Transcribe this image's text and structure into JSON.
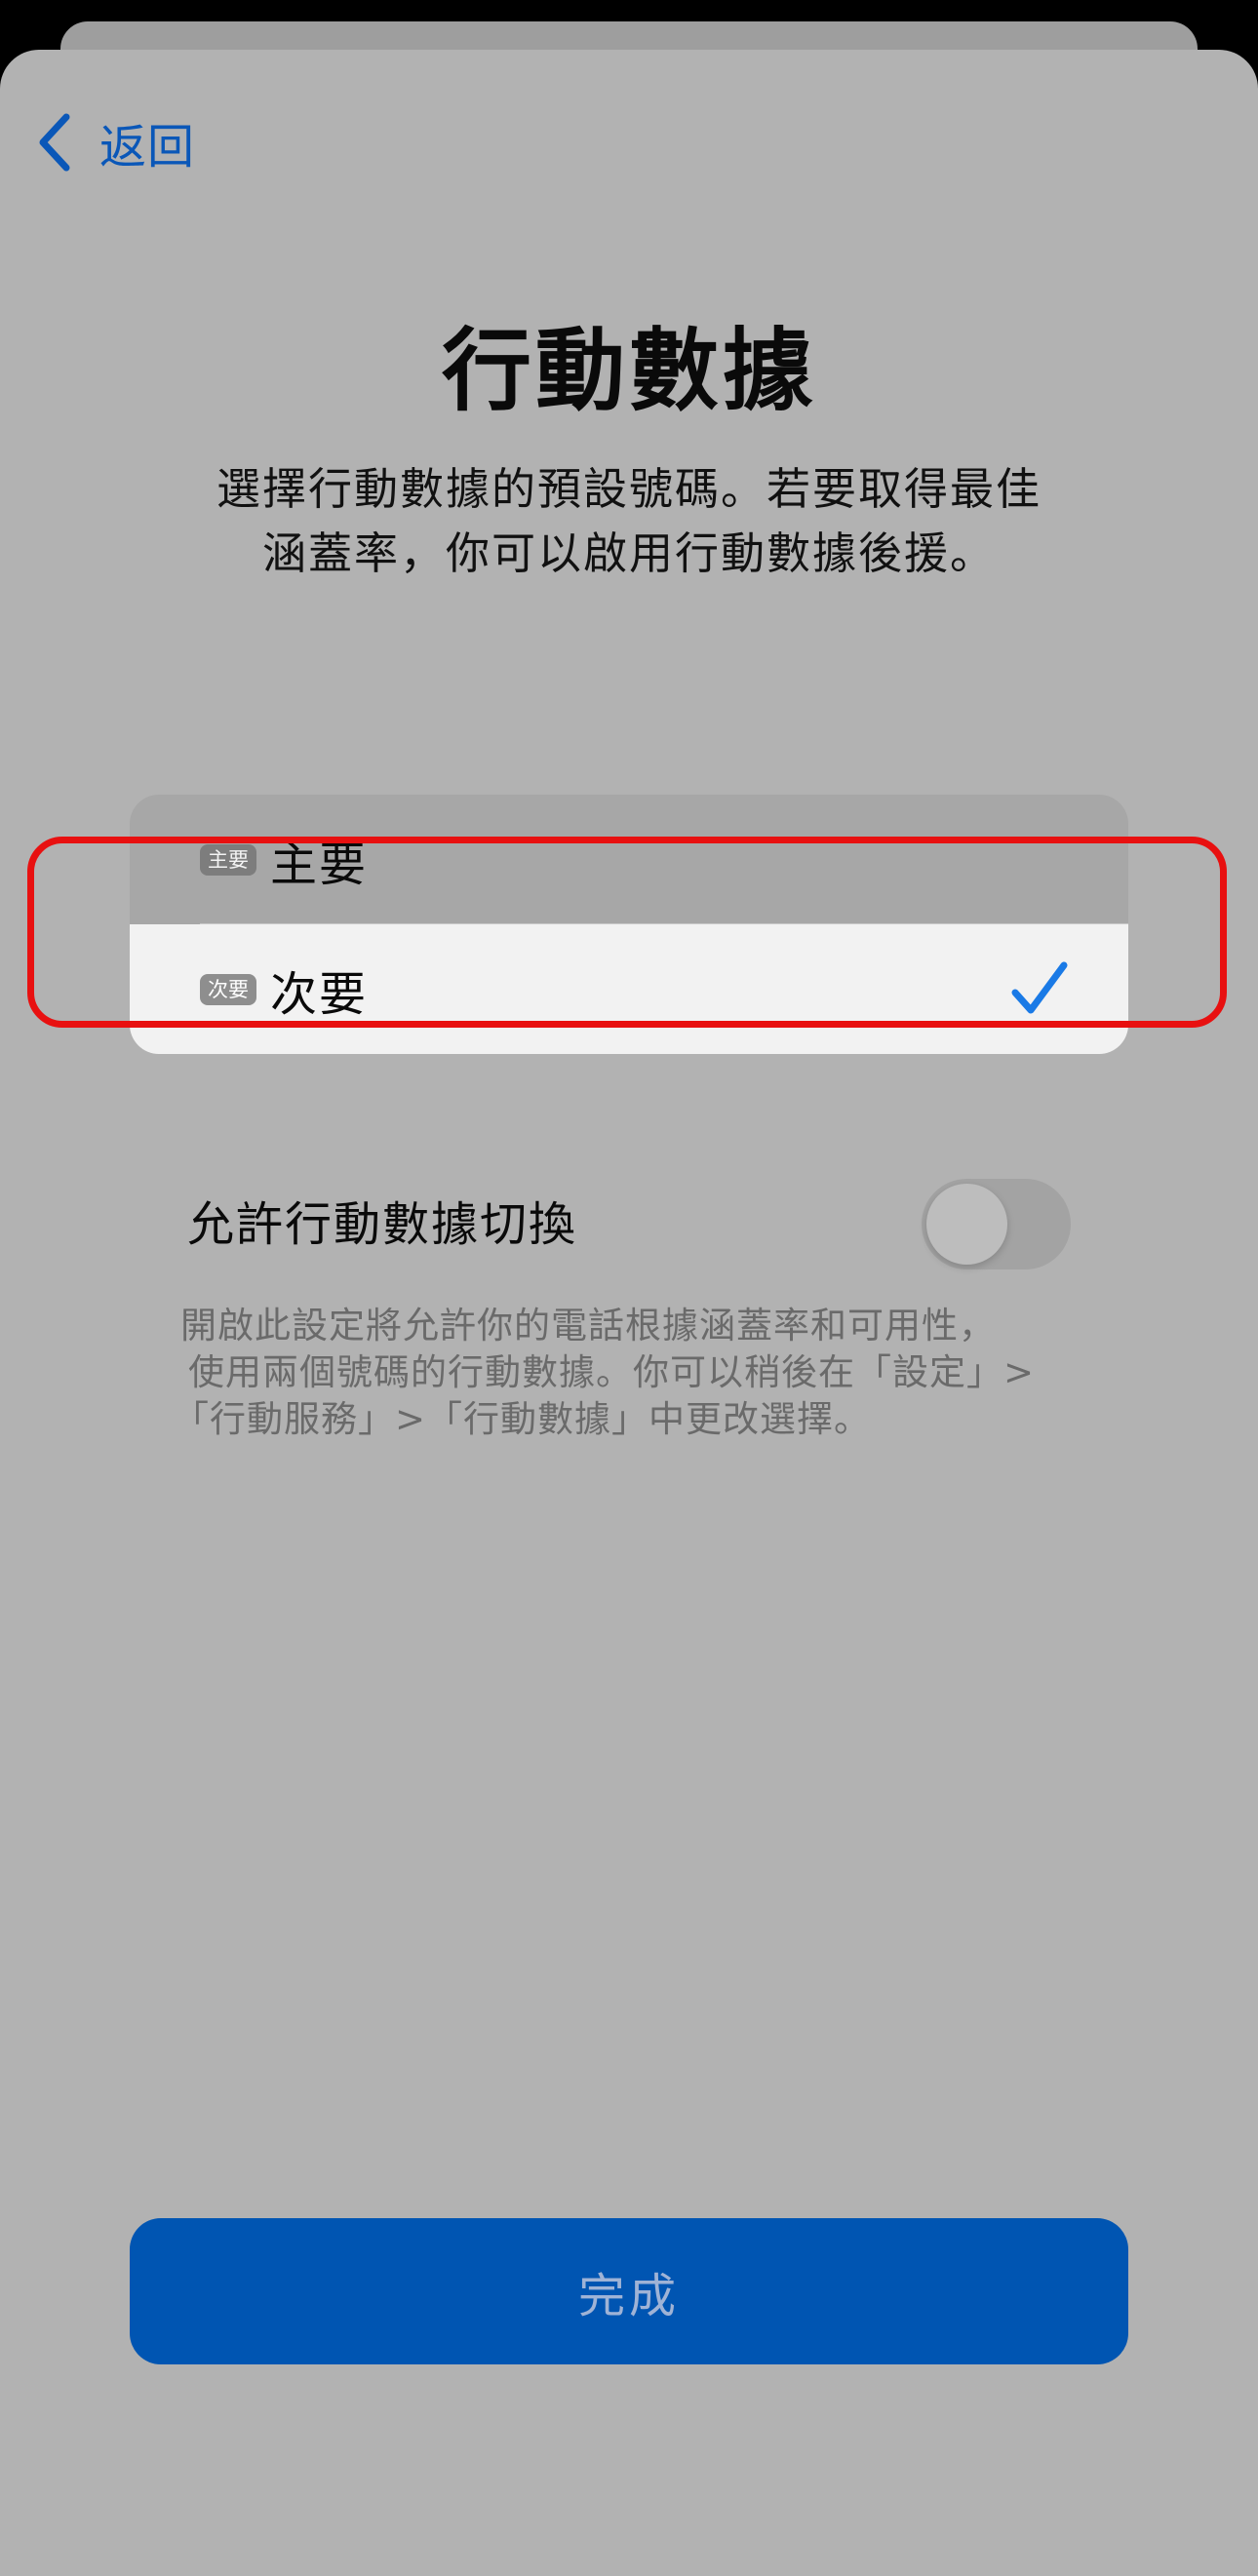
{
  "nav": {
    "back_label": "返回"
  },
  "title": "行動數據",
  "subtitle": "選擇行動數據的預設號碼。若要取得最佳涵蓋率，你可以啟用行動數據後援。",
  "lines": [
    {
      "badge": "主要",
      "label": "主要",
      "selected": false
    },
    {
      "badge": "次要",
      "label": "次要",
      "selected": true
    }
  ],
  "switching": {
    "label": "允許行動數據切換",
    "enabled": false,
    "footnote_lines": [
      "開啟此設定將允許你的電話根據涵蓋率和可用性，",
      "使用兩個號碼的行動數據。你可以稍後在「設定」>",
      "「行動服務」>「行動數據」中更改選擇。"
    ]
  },
  "done_label": "完成",
  "colors": {
    "accent": "#0a57b8",
    "button": "#0055b2",
    "checkmark": "#1a7ae6",
    "highlight_border": "#e81010"
  }
}
